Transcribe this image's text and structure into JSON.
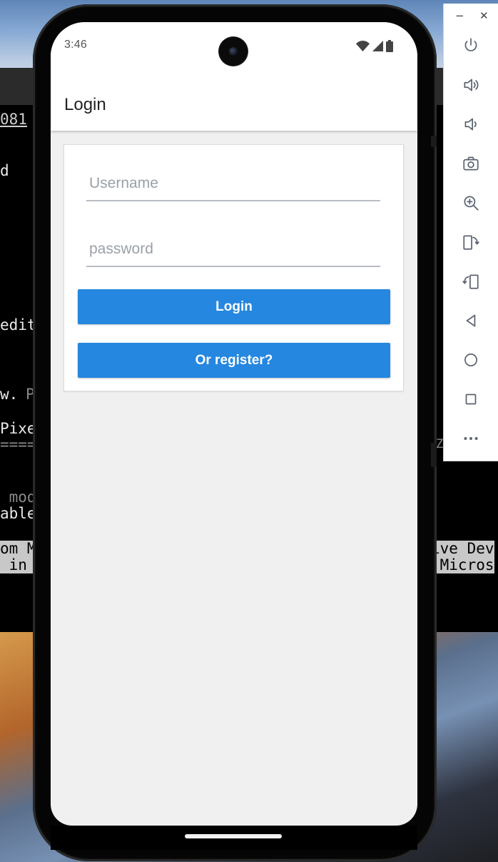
{
  "emulator_toolbar": {
    "minimize_label": "−",
    "close_label": "✕",
    "buttons": [
      {
        "icon": "power-icon"
      },
      {
        "icon": "volume-up-icon"
      },
      {
        "icon": "volume-down-icon"
      },
      {
        "icon": "camera-icon"
      },
      {
        "icon": "zoom-in-icon"
      },
      {
        "icon": "rotate-left-icon"
      },
      {
        "icon": "rotate-right-icon"
      },
      {
        "icon": "back-icon"
      },
      {
        "icon": "home-icon"
      },
      {
        "icon": "overview-icon"
      },
      {
        "icon": "more-icon"
      }
    ]
  },
  "background_terminal": {
    "line_1": "081",
    "line_2": "d",
    "line_3": "edit",
    "line_4a": "w. ",
    "line_4b": "P",
    "line_5": "Pixe",
    "line_6": "====",
    "line_6r": "Z",
    "line_7": " mod",
    "line_8": "able",
    "status_left_1": "om M",
    "status_left_2": " in ",
    "status_right_1": "ive Dev",
    "status_right_2": " Micros"
  },
  "device": {
    "status_bar": {
      "time": "3:46",
      "icons": [
        "wifi-icon",
        "cell-signal-icon",
        "battery-icon"
      ]
    },
    "app_bar": {
      "title": "Login"
    },
    "login_form": {
      "username": {
        "placeholder": "Username",
        "value": ""
      },
      "password": {
        "placeholder": "password",
        "value": ""
      },
      "login_button": "Login",
      "register_button": "Or register?"
    }
  },
  "colors": {
    "primary_button": "#2587e0",
    "screen_background": "#f0f0f0",
    "app_bar": "#ffffff"
  }
}
